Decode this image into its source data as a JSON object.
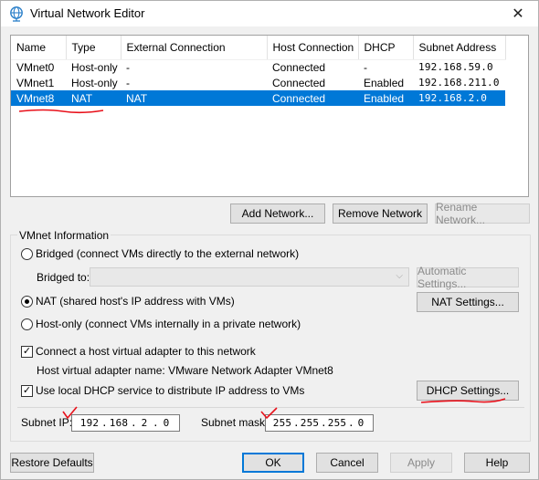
{
  "window": {
    "title": "Virtual Network Editor",
    "close_glyph": "✕"
  },
  "table": {
    "headers": [
      "Name",
      "Type",
      "External Connection",
      "Host Connection",
      "DHCP",
      "Subnet Address"
    ],
    "rows": [
      [
        "VMnet0",
        "Host-only",
        "-",
        "Connected",
        "-",
        "192.168.59.0"
      ],
      [
        "VMnet1",
        "Host-only",
        "-",
        "Connected",
        "Enabled",
        "192.168.211.0"
      ],
      [
        "VMnet8",
        "NAT",
        "NAT",
        "Connected",
        "Enabled",
        "192.168.2.0"
      ]
    ],
    "selected_row": 2
  },
  "list_buttons": {
    "add": "Add Network...",
    "remove": "Remove Network",
    "rename": "Rename Network..."
  },
  "vmnet_info": {
    "group_label": "VMnet Information",
    "bridged_label": "Bridged (connect VMs directly to the external network)",
    "bridged_to_label": "Bridged to:",
    "automatic_settings": "Automatic Settings...",
    "nat_label": "NAT (shared host's IP address with VMs)",
    "nat_settings": "NAT Settings...",
    "hostonly_label": "Host-only (connect VMs internally in a private network)",
    "connect_adapter_label": "Connect a host virtual adapter to this network",
    "adapter_name_label": "Host virtual adapter name: VMware Network Adapter VMnet8",
    "dhcp_label": "Use local DHCP service to distribute IP address to VMs",
    "dhcp_settings": "DHCP Settings...",
    "connection_type": "nat",
    "connect_adapter_checked": true,
    "dhcp_checked": true
  },
  "subnet": {
    "ip_label": "Subnet IP:",
    "ip": [
      "192",
      "168",
      "2",
      "0"
    ],
    "mask_label": "Subnet mask:",
    "mask": [
      "255",
      "255",
      "255",
      "0"
    ],
    "dot": "."
  },
  "bottom_buttons": {
    "restore": "Restore Defaults",
    "ok": "OK",
    "cancel": "Cancel",
    "apply": "Apply",
    "help": "Help"
  },
  "colors": {
    "selection": "#0078d7",
    "annotation": "#e8101a"
  }
}
